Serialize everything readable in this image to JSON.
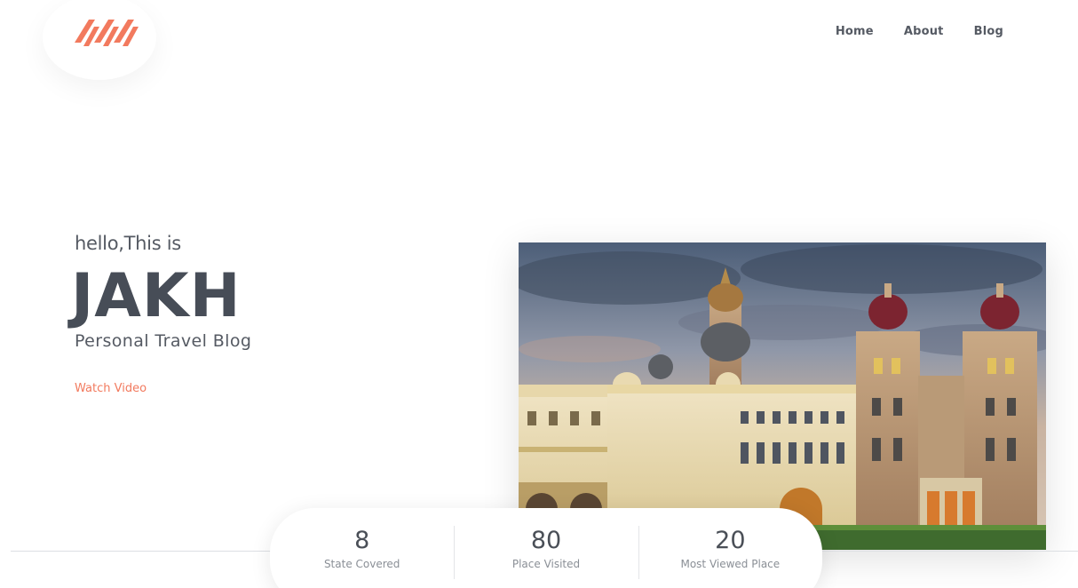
{
  "header": {
    "logo_name": "brand-logo",
    "nav": [
      {
        "label": "Home"
      },
      {
        "label": "About"
      },
      {
        "label": "Blog"
      }
    ]
  },
  "hero": {
    "greeting": "hello,This is",
    "name": "JAKH",
    "subtitle": "Personal Travel Blog",
    "cta": "Watch Video",
    "image_subject": "palace-photo"
  },
  "stats": [
    {
      "value": "8",
      "label": "State Covered"
    },
    {
      "value": "80",
      "label": "Place Visited"
    },
    {
      "value": "20",
      "label": "Most Viewed Place"
    }
  ],
  "colors": {
    "accent": "#f27a5e",
    "text": "#4a4f57",
    "muted": "#8a8f96"
  }
}
